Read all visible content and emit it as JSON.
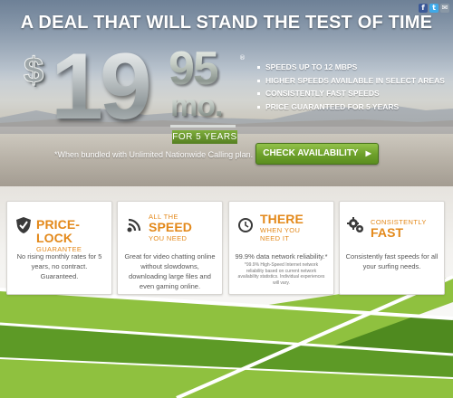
{
  "share": {
    "facebook": "f",
    "twitter": "t",
    "email": "✉"
  },
  "headline": "A DEAL THAT WILL STAND THE TEST OF TIME",
  "price": {
    "currency": "$",
    "whole": "19",
    "cents": "95",
    "per": "mo.",
    "registered": "®",
    "term": "FOR 5 YEARS"
  },
  "bundle_note": "*When bundled with Unlimited Nationwide Calling plan.",
  "features": [
    "SPEEDS UP TO 12 MBPS",
    "HIGHER SPEEDS AVAILABLE IN SELECT AREAS",
    "CONSISTENTLY FAST SPEEDS",
    "PRICE GUARANTEED FOR 5 YEARS"
  ],
  "cta": {
    "label": "CHECK AVAILABILITY",
    "arrow": "▶"
  },
  "cards": [
    {
      "icon": "shield-check-icon",
      "title_big": "PRICE-LOCK",
      "title_small": "GUARANTEE",
      "body": "No rising monthly rates for 5 years, no contract. Guaranteed."
    },
    {
      "icon": "signal-wave-icon",
      "title_small_top": "ALL THE",
      "title_big": "SPEED",
      "title_small": "YOU NEED",
      "body": "Great for video chatting online without slowdowns, downloading large files and even gaming online."
    },
    {
      "icon": "clock-icon",
      "title_big": "THERE",
      "title_small": "WHEN YOU NEED IT",
      "body": "99.9% data network reliability.*",
      "fine_print": "*99.9% High-Speed Internet network reliability based on current network availability statistics. Individual experiences will vary."
    },
    {
      "icon": "gears-icon",
      "title_small": "CONSISTENTLY",
      "title_big": "FAST",
      "body": "Consistently fast speeds for all your surfing needs."
    }
  ],
  "colors": {
    "accent_orange": "#e3891b",
    "cta_green": "#6fa22c",
    "stripe_green_light": "#8fc13f",
    "stripe_green_dark": "#4f8a1f"
  }
}
